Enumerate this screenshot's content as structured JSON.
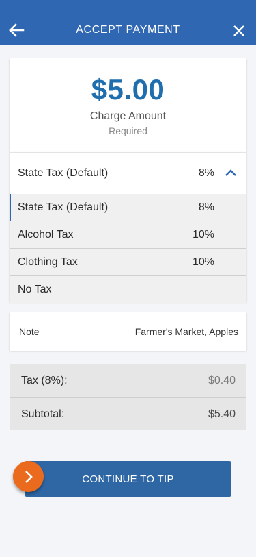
{
  "header": {
    "title": "ACCEPT PAYMENT",
    "back_icon": "arrow-left-icon",
    "close_icon": "close-icon"
  },
  "amount_card": {
    "amount": "$5.00",
    "label": "Charge Amount",
    "required": "Required"
  },
  "tax": {
    "selected_name": "State Tax (Default)",
    "selected_rate": "8%",
    "options": [
      {
        "name": "State Tax (Default)",
        "rate": "8%"
      },
      {
        "name": "Alcohol Tax",
        "rate": "10%"
      },
      {
        "name": "Clothing Tax",
        "rate": "10%"
      },
      {
        "name": "No Tax",
        "rate": ""
      }
    ]
  },
  "note": {
    "label": "Note",
    "value": "Farmer's Market, Apples"
  },
  "totals": {
    "tax_label": "Tax (8%):",
    "tax_value": "$0.40",
    "subtotal_label": "Subtotal:",
    "subtotal_value": "$5.40"
  },
  "continue_button": {
    "label": "CONTINUE TO TIP"
  },
  "colors": {
    "header": "#2f67b2",
    "amount": "#1f6fae",
    "accent_orange": "#ea6b1e"
  }
}
